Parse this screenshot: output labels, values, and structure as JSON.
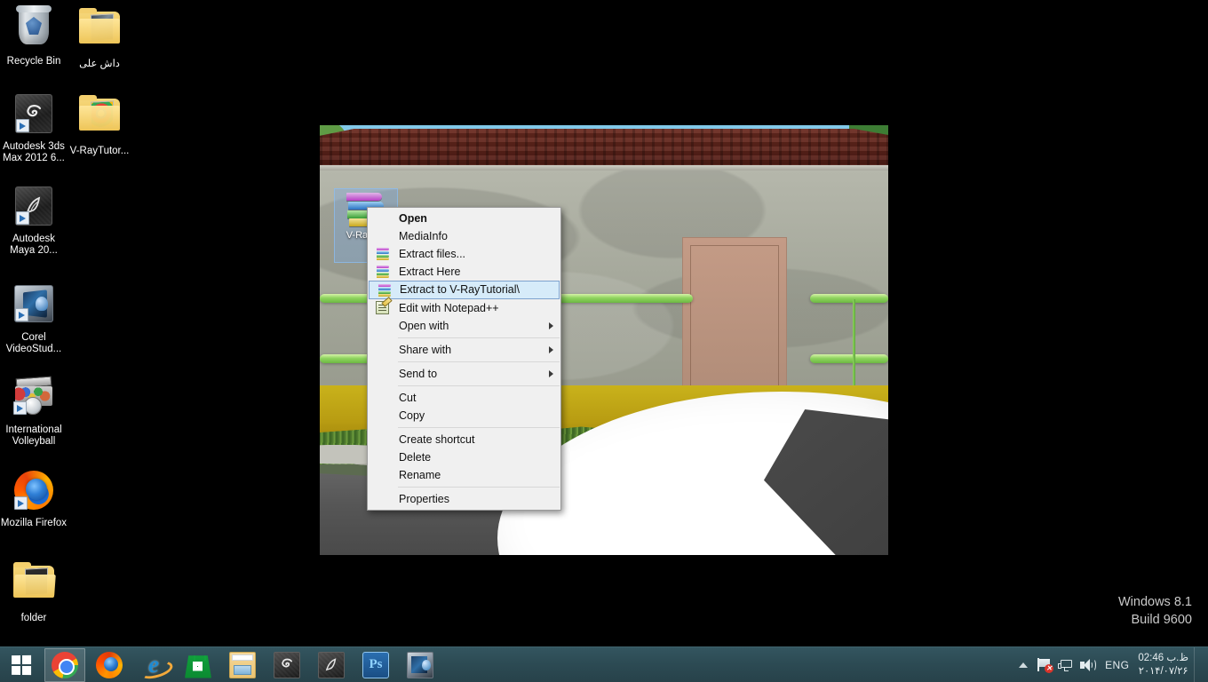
{
  "desktop": {
    "icons": [
      {
        "label": "Recycle Bin",
        "icon": "recycle-bin-icon",
        "rtl": false
      },
      {
        "label": "داش على",
        "icon": "folder-icon",
        "rtl": true
      },
      {
        "label": "Autodesk 3ds Max 2012 6...",
        "icon": "3ds-max-icon",
        "rtl": false
      },
      {
        "label": "V-RayTutor...",
        "icon": "folder-icon",
        "rtl": false
      },
      {
        "label": "Autodesk Maya 20...",
        "icon": "maya-icon",
        "rtl": false
      },
      {
        "label": "Corel VideoStud...",
        "icon": "corel-videostudio-icon",
        "rtl": false
      },
      {
        "label": "International Volleyball",
        "icon": "volleyball-game-icon",
        "rtl": false
      },
      {
        "label": "Mozilla Firefox",
        "icon": "firefox-icon",
        "rtl": false
      },
      {
        "label": "folder",
        "icon": "open-folder-icon",
        "rtl": false
      }
    ]
  },
  "selected_file": {
    "label": "V-RayT...",
    "icon": "winrar-archive-icon"
  },
  "context_menu": {
    "items": [
      {
        "label": "Open",
        "bold": true,
        "icon": null,
        "submenu": false,
        "highlight": false,
        "separator_after": false
      },
      {
        "label": "MediaInfo",
        "bold": false,
        "icon": null,
        "submenu": false,
        "highlight": false,
        "separator_after": false
      },
      {
        "label": "Extract files...",
        "bold": false,
        "icon": "winrar-icon",
        "submenu": false,
        "highlight": false,
        "separator_after": false
      },
      {
        "label": "Extract Here",
        "bold": false,
        "icon": "winrar-icon",
        "submenu": false,
        "highlight": false,
        "separator_after": false
      },
      {
        "label": "Extract to V-RayTutorial\\",
        "bold": false,
        "icon": "winrar-icon",
        "submenu": false,
        "highlight": true,
        "separator_after": false
      },
      {
        "label": "Edit with Notepad++",
        "bold": false,
        "icon": "notepadpp-icon",
        "submenu": false,
        "highlight": false,
        "separator_after": false
      },
      {
        "label": "Open with",
        "bold": false,
        "icon": null,
        "submenu": true,
        "highlight": false,
        "separator_after": true
      },
      {
        "label": "Share with",
        "bold": false,
        "icon": null,
        "submenu": true,
        "highlight": false,
        "separator_after": true
      },
      {
        "label": "Send to",
        "bold": false,
        "icon": null,
        "submenu": true,
        "highlight": false,
        "separator_after": true
      },
      {
        "label": "Cut",
        "bold": false,
        "icon": null,
        "submenu": false,
        "highlight": false,
        "separator_after": false
      },
      {
        "label": "Copy",
        "bold": false,
        "icon": null,
        "submenu": false,
        "highlight": false,
        "separator_after": true
      },
      {
        "label": "Create shortcut",
        "bold": false,
        "icon": null,
        "submenu": false,
        "highlight": false,
        "separator_after": false
      },
      {
        "label": "Delete",
        "bold": false,
        "icon": null,
        "submenu": false,
        "highlight": false,
        "separator_after": false
      },
      {
        "label": "Rename",
        "bold": false,
        "icon": null,
        "submenu": false,
        "highlight": false,
        "separator_after": true
      },
      {
        "label": "Properties",
        "bold": false,
        "icon": null,
        "submenu": false,
        "highlight": false,
        "separator_after": false
      }
    ],
    "highlight_color": "#d6ebf9",
    "highlight_border": "#7da2ce",
    "background": "#f0f0f0"
  },
  "watermark": {
    "line1": "Windows 8.1",
    "line2": "Build 9600"
  },
  "taskbar": {
    "background": "#2c4a53",
    "start": {
      "name": "start-button",
      "label": "Start"
    },
    "apps": [
      {
        "name": "taskbar-chrome",
        "label": "Google Chrome",
        "icon": "chrome-icon",
        "active": true
      },
      {
        "name": "taskbar-firefox",
        "label": "Mozilla Firefox",
        "icon": "firefox-icon",
        "active": false
      },
      {
        "name": "taskbar-ie",
        "label": "Internet Explorer",
        "icon": "internet-explorer-icon",
        "active": false
      },
      {
        "name": "taskbar-store",
        "label": "Store",
        "icon": "windows-store-icon",
        "active": false
      },
      {
        "name": "taskbar-explorer",
        "label": "File Explorer",
        "icon": "file-explorer-icon",
        "active": false
      },
      {
        "name": "taskbar-3dsmax",
        "label": "Autodesk 3ds Max",
        "icon": "3ds-max-icon",
        "active": false
      },
      {
        "name": "taskbar-maya",
        "label": "Autodesk Maya",
        "icon": "maya-icon",
        "active": false
      },
      {
        "name": "taskbar-photoshop",
        "label": "Adobe Photoshop",
        "icon": "photoshop-icon",
        "active": false
      },
      {
        "name": "taskbar-corel",
        "label": "Corel VideoStudio",
        "icon": "corel-videostudio-icon",
        "active": false
      }
    ],
    "tray": {
      "chevron": "show-hidden-icons",
      "flag": "action-center-icon",
      "flag_badge": "✕",
      "network": "network-icon",
      "volume": "volume-icon",
      "language": "ENG",
      "clock_time": "02:46 ظ.ب",
      "clock_date": "۲۰۱۴/۰۷/۲۶"
    }
  },
  "render_image": {
    "description": "3D architectural render",
    "ps_label": "Ps"
  }
}
